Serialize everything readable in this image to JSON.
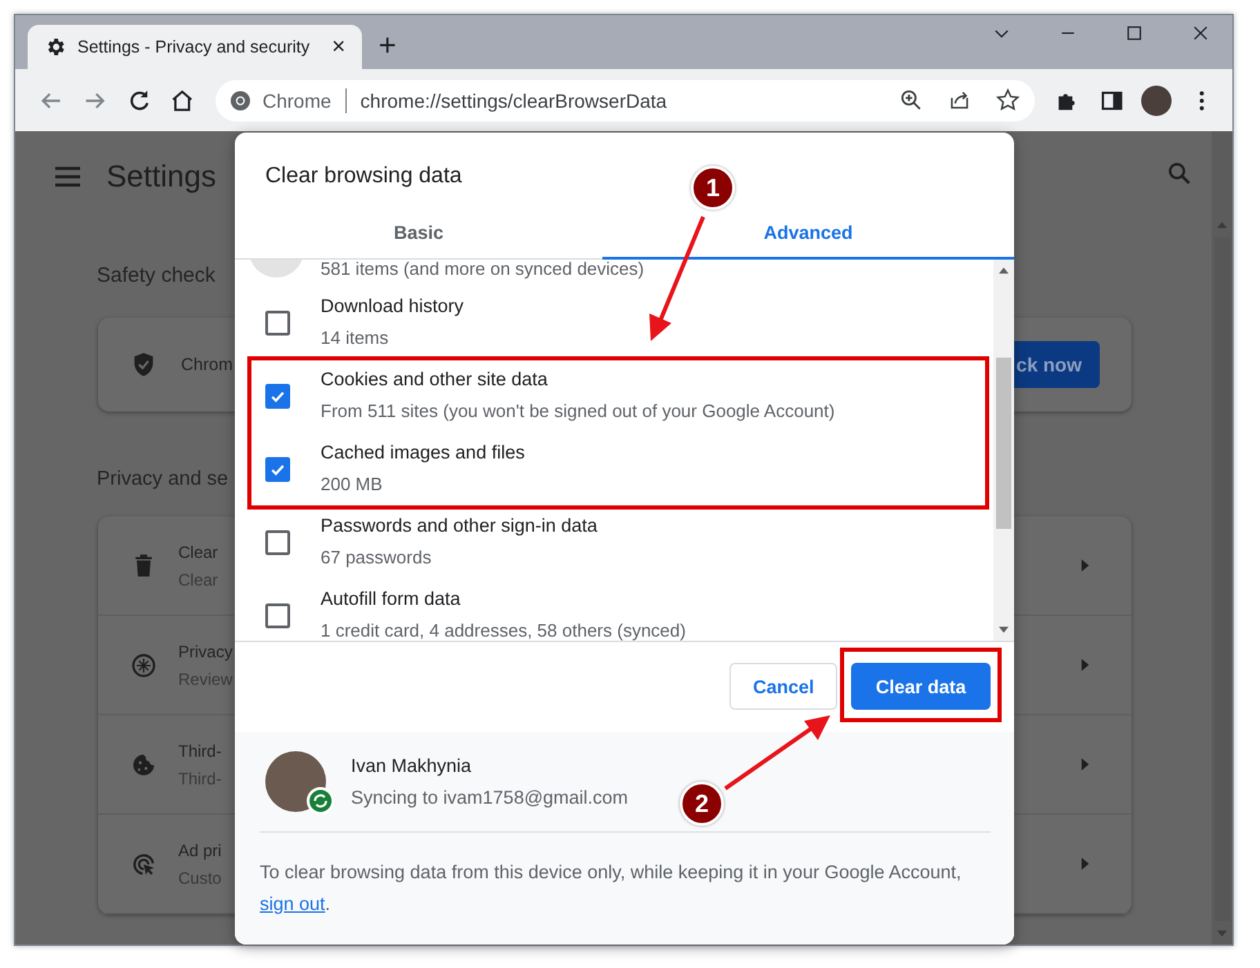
{
  "browser": {
    "tab": {
      "title": "Settings - Privacy and security",
      "close": "×"
    },
    "new_tab": "+",
    "omnibox": {
      "site_label": "Chrome",
      "url": "chrome://settings/clearBrowserData"
    }
  },
  "settings": {
    "title": "Settings",
    "safety_heading": "Safety check",
    "safety_card": {
      "text": "Chrom",
      "button": "ck now"
    },
    "privacy_heading": "Privacy and se",
    "privacy_rows": [
      {
        "kind": "trash",
        "title": "Clear",
        "subtitle": "Clear"
      },
      {
        "kind": "compass",
        "title": "Privacy",
        "subtitle": "Review"
      },
      {
        "kind": "cookie",
        "title": "Third-",
        "subtitle": "Third-"
      },
      {
        "kind": "target",
        "title": "Ad pri",
        "subtitle": "Custo"
      }
    ]
  },
  "dialog": {
    "title": "Clear browsing data",
    "tabs": [
      {
        "label": "Basic",
        "selected": false
      },
      {
        "label": "Advanced",
        "selected": true
      }
    ],
    "items": [
      {
        "detail": "581 items (and more on synced devices)"
      },
      {
        "label": "Download history",
        "detail": "14 items",
        "checked": false
      },
      {
        "label": "Cookies and other site data",
        "detail": "From 511 sites (you won't be signed out of your Google Account)",
        "checked": true
      },
      {
        "label": "Cached images and files",
        "detail": "200 MB",
        "checked": true
      },
      {
        "label": "Passwords and other sign-in data",
        "detail": "67 passwords",
        "checked": false
      },
      {
        "label": "Autofill form data",
        "detail": "1 credit card, 4 addresses, 58 others (synced)",
        "checked": false
      }
    ],
    "buttons": [
      {
        "label": "Cancel",
        "kind": "secondary"
      },
      {
        "label": "Clear data",
        "kind": "primary"
      }
    ],
    "account": {
      "name": "Ivan Makhynia",
      "status": "Syncing to ivam1758@gmail.com"
    },
    "note": {
      "before": "To clear browsing data from this device only, while keeping it in your Google Account, ",
      "link": "sign out",
      "after": "."
    }
  },
  "annotations": [
    {
      "label": "1"
    },
    {
      "label": "2"
    }
  ]
}
